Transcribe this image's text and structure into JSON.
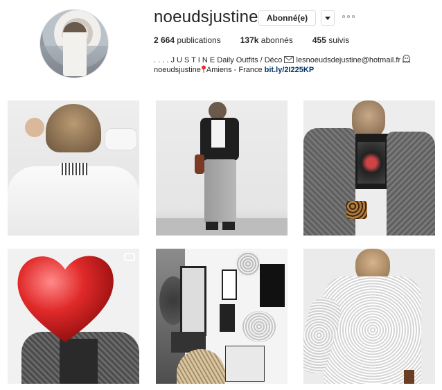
{
  "profile": {
    "username": "noeudsjustine",
    "follow_label": "Abonné(e)",
    "stats": [
      {
        "value": "2 664",
        "label": "publications"
      },
      {
        "value": "137k",
        "label": "abonnés"
      },
      {
        "value": "455",
        "label": "suivis"
      }
    ],
    "bio_line1": ". . . . J U S T I N E Daily Outfits / Déco",
    "bio_email": "lesnoeudsdejustine@hotmail.fr",
    "bio_line2_handle": "noeudsjustine",
    "bio_line2_location": "Amiens - France",
    "bio_link": "bit.ly/2I225KP"
  },
  "icons": {
    "more": "ellipsis-icon",
    "dropdown": "chevron-down-icon",
    "email": "envelope-icon",
    "ghost": "ghost-icon",
    "pin": "pin-icon",
    "video": "video-icon"
  },
  "colors": {
    "link": "#003569",
    "border": "#dbdbdb",
    "text": "#262626"
  }
}
